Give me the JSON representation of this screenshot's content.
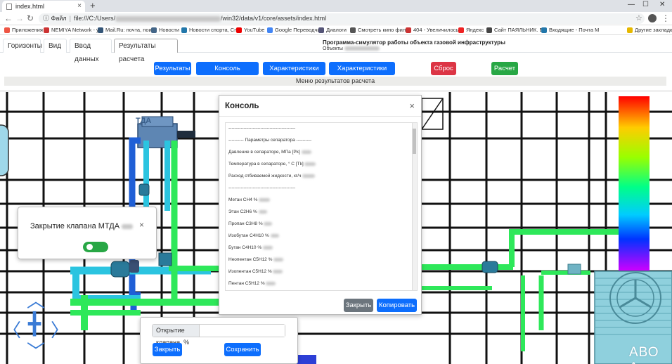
{
  "browser": {
    "tab_title": "index.html",
    "url_prefix": "Файл",
    "url_start": "file:///C:/Users/",
    "url_end": "/win32/data/v1/core/assets/index.html",
    "bookmarks": [
      {
        "label": "Приложения",
        "color": "#e54"
      },
      {
        "label": "NEMIYA Network - у",
        "color": "#c33"
      },
      {
        "label": "Mail.Ru: почта, поис",
        "color": "#357"
      },
      {
        "label": "Новости",
        "color": "#468"
      },
      {
        "label": "Новости спорта, Спо",
        "color": "#27a"
      },
      {
        "label": "YouTube",
        "color": "#e00"
      },
      {
        "label": "Google Переводчик",
        "color": "#4285f4"
      },
      {
        "label": "Диалоги",
        "color": "#557"
      },
      {
        "label": "Смотреть кино фил",
        "color": "#555"
      },
      {
        "label": "404 - Увеличилось",
        "color": "#c33"
      },
      {
        "label": "Яндекс",
        "color": "#e22"
      },
      {
        "label": "Сайт ПАЯЛЬНИК. Е",
        "color": "#444"
      },
      {
        "label": "Входящие - Почта М",
        "color": "#27a"
      },
      {
        "label": "Другие закладки",
        "color": "#e6b800"
      }
    ]
  },
  "toolbar": {
    "tabs": [
      "Горизонты",
      "Вид",
      "Ввод данных",
      "Результаты расчета"
    ],
    "app_title": "Программа-симулятор работы объекта газовой инфраструктуры",
    "object_label": "Объекты",
    "buttons": {
      "results": "Результаты",
      "console_results": "Консоль результатов",
      "gka": "Характеристики ГКА",
      "mtda": "Характеристики МТДА",
      "reset": "Сброс",
      "calc": "Расчет"
    },
    "menu_label": "Меню результатов расчета"
  },
  "scheme": {
    "tda_label": "ТДА",
    "abo_label": "АВО А"
  },
  "console": {
    "title": "Консоль",
    "lines": [
      "--------------------------------------------",
      "---------- Параметры сепаратора ----------",
      "Давление в сепараторе, МПа [Pk]",
      "Температура в сепараторе, ° С [Tk]",
      "Расход отбиваемой жидкости, кг/ч",
      "--------------------------------------------",
      "Метан CH4 %",
      "Этан C2H6 %",
      "Пропан C3H8 %",
      "Изобутан C4H10 %",
      "Бутан C4H10 %",
      "Неопентан C5H12 %",
      "Изопентан C5H12 %",
      "Пентан C5H12 %"
    ],
    "close_label": "Закрыть",
    "copy_label": "Копировать"
  },
  "valve_panel": {
    "title": "Закрытие клапана МТДА"
  },
  "open_panel": {
    "input_label": "Открытие клапана, %",
    "input_value": "",
    "close_label": "Закрыть",
    "save_label": "Сохранить"
  },
  "colors": {
    "primary": "#0d6efd",
    "danger": "#dc3545",
    "success": "#28a745",
    "secondary": "#6c757d",
    "pipe_green": "#2ee85a",
    "pipe_cyan": "#2bc4e0",
    "pipe_blue": "#1f5fd6"
  }
}
